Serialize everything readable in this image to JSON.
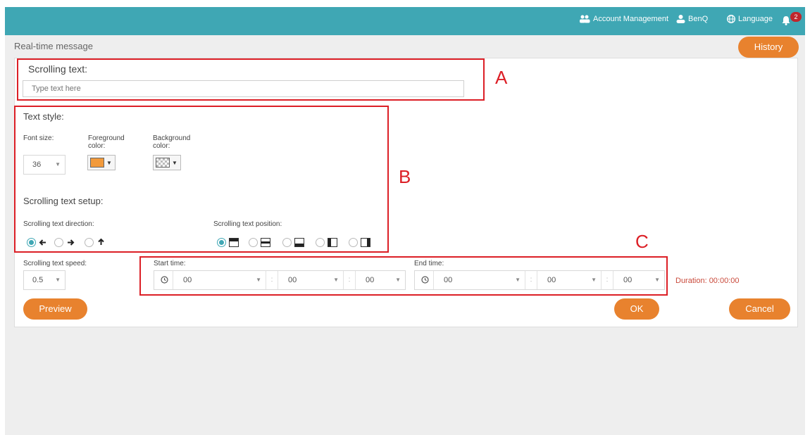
{
  "topbar": {
    "account_management": "Account Management",
    "user": "BenQ",
    "language": "Language",
    "notification_count": "2"
  },
  "page": {
    "title": "Real-time message",
    "history_label": "History"
  },
  "scrolling_text": {
    "title": "Scrolling text:",
    "placeholder": "Type text here",
    "value": ""
  },
  "text_style": {
    "title": "Text style:",
    "font_size_label": "Font size:",
    "font_size_value": "36",
    "foreground_label": "Foreground color:",
    "foreground_color": "#f29a3b",
    "background_label": "Background color:"
  },
  "setup": {
    "title": "Scrolling text setup:",
    "direction_label": "Scrolling text direction:",
    "directions": [
      {
        "icon": "arrow-left-icon",
        "glyph": "🡐",
        "selected": true
      },
      {
        "icon": "arrow-right-icon",
        "glyph": "🡒",
        "selected": false
      },
      {
        "icon": "arrow-up-icon",
        "glyph": "🡑",
        "selected": false
      }
    ],
    "position_label": "Scrolling text position:",
    "positions": [
      {
        "icon": "position-top-icon",
        "selected": true
      },
      {
        "icon": "position-middle-icon",
        "selected": false
      },
      {
        "icon": "position-bottom-icon",
        "selected": false
      },
      {
        "icon": "position-left-icon",
        "selected": false
      },
      {
        "icon": "position-right-icon",
        "selected": false
      }
    ]
  },
  "speed": {
    "label": "Scrolling text speed:",
    "value": "0.5"
  },
  "start_time": {
    "label": "Start time:",
    "hour": "00",
    "minute": "00",
    "second": "00"
  },
  "end_time": {
    "label": "End time:",
    "hour": "00",
    "minute": "00",
    "second": "00"
  },
  "duration": "Duration: 00:00:00",
  "buttons": {
    "preview": "Preview",
    "ok": "OK",
    "cancel": "Cancel"
  },
  "callouts": {
    "a": "A",
    "b": "B",
    "c": "C"
  },
  "colors": {
    "topbar": "#3fa7b4",
    "accent": "#e8822e",
    "radio": "#3fa7b4",
    "callout": "#dc1f26"
  }
}
